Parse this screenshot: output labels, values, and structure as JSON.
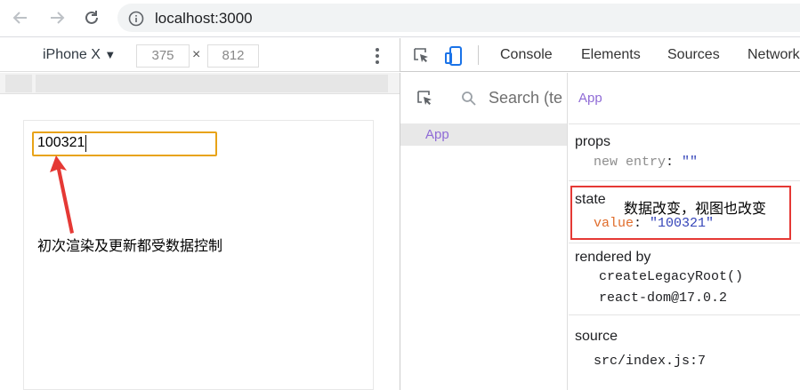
{
  "browser": {
    "url": "localhost:3000"
  },
  "device_toolbar": {
    "device": "iPhone X",
    "width": "375",
    "separator": "×",
    "height": "812"
  },
  "devtools": {
    "tabs": [
      "Console",
      "Elements",
      "Sources",
      "Network"
    ]
  },
  "components": {
    "search_placeholder": "Search (te",
    "tree": [
      "App"
    ],
    "selected": "App",
    "props": {
      "title": "props",
      "key": "new entry",
      "colon": ":",
      "value": "\"\""
    },
    "state": {
      "title": "state",
      "key": "value",
      "colon": ":",
      "value": "\"100321\""
    },
    "rendered_by": {
      "title": "rendered by",
      "items": [
        "createLegacyRoot()",
        "react-dom@17.0.2"
      ]
    },
    "source": {
      "title": "source",
      "value": "src/index.js:7"
    }
  },
  "app": {
    "input_value": "100321"
  },
  "annotations": {
    "left": "初次渲染及更新都受数据控制",
    "right": "数据改变，视图也改变"
  },
  "colors": {
    "input_border": "#e8a317",
    "highlight_box": "#e53935",
    "arrow": "#e53935",
    "component_name": "#8f6bd6"
  }
}
